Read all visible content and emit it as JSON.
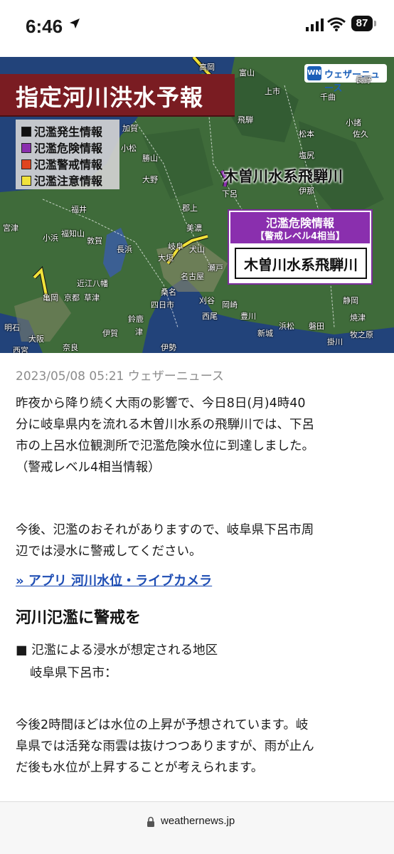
{
  "status_bar": {
    "time": "6:46",
    "battery": "87"
  },
  "map": {
    "title": "指定河川洪水予報",
    "logo_text": "ウェザーニュース",
    "logo_mark": "WN",
    "legend": [
      {
        "label": "氾濫発生情報",
        "color": "#111111"
      },
      {
        "label": "氾濫危険情報",
        "color": "#8a2fae"
      },
      {
        "label": "氾濫警戒情報",
        "color": "#e0451f"
      },
      {
        "label": "氾濫注意情報",
        "color": "#f1e23a"
      }
    ],
    "river_label": "木曽川水系飛騨川",
    "alert": {
      "level_title": "氾濫危険情報",
      "level_sub": "【警戒レベル4相当】",
      "river": "木曽川水系飛騨川"
    },
    "places": [
      "高岡",
      "富山",
      "上市",
      "千曲",
      "長野",
      "小諸",
      "佐久",
      "松本",
      "飛騨",
      "塩尻",
      "加賀",
      "小松",
      "勝山",
      "大野",
      "郡上",
      "伊那",
      "下呂",
      "宮津",
      "福知山",
      "美濃",
      "長浜",
      "犬山",
      "大垣",
      "岐阜",
      "瀬戸",
      "名古屋",
      "豊田",
      "近江八幡",
      "亀岡",
      "京都",
      "草津",
      "四日市",
      "刈谷",
      "西尾",
      "岡崎",
      "豊川",
      "浜松",
      "磐田",
      "静岡",
      "焼津",
      "鈴鹿",
      "伊賀",
      "津",
      "桑名",
      "明石",
      "大阪",
      "奈良",
      "伊勢",
      "西宮",
      "宮津",
      "福井",
      "敦賀",
      "小浜",
      "新城",
      "掛川",
      "牧之原"
    ]
  },
  "article": {
    "meta": "2023/05/08 05:21 ウェザーニュース",
    "para1": [
      "昨夜から降り続く大雨の影響で、今日8日(月)4時40",
      "分に岐阜県内を流れる木曽川水系の飛騨川では、下呂",
      "市の上呂水位観測所で氾濫危険水位に到達しました。",
      "（警戒レベル4相当情報）"
    ],
    "para2": [
      "今後、氾濫のおそれがありますので、岐阜県下呂市周",
      "辺では浸水に警戒してください。"
    ],
    "link": "» アプリ 河川水位・ライブカメラ",
    "heading": "河川氾濫に警戒を",
    "bullet": "■ 氾濫による浸水が想定される地区",
    "bullet_sub": "岐阜県下呂市：",
    "para3": [
      "今後2時間ほどは水位の上昇が予想されています。岐",
      "阜県では活発な雨雲は抜けつつありますが、雨が止ん",
      "だ後も水位が上昇することが考えられます。"
    ]
  },
  "browser": {
    "url": "weathernews.jp"
  }
}
